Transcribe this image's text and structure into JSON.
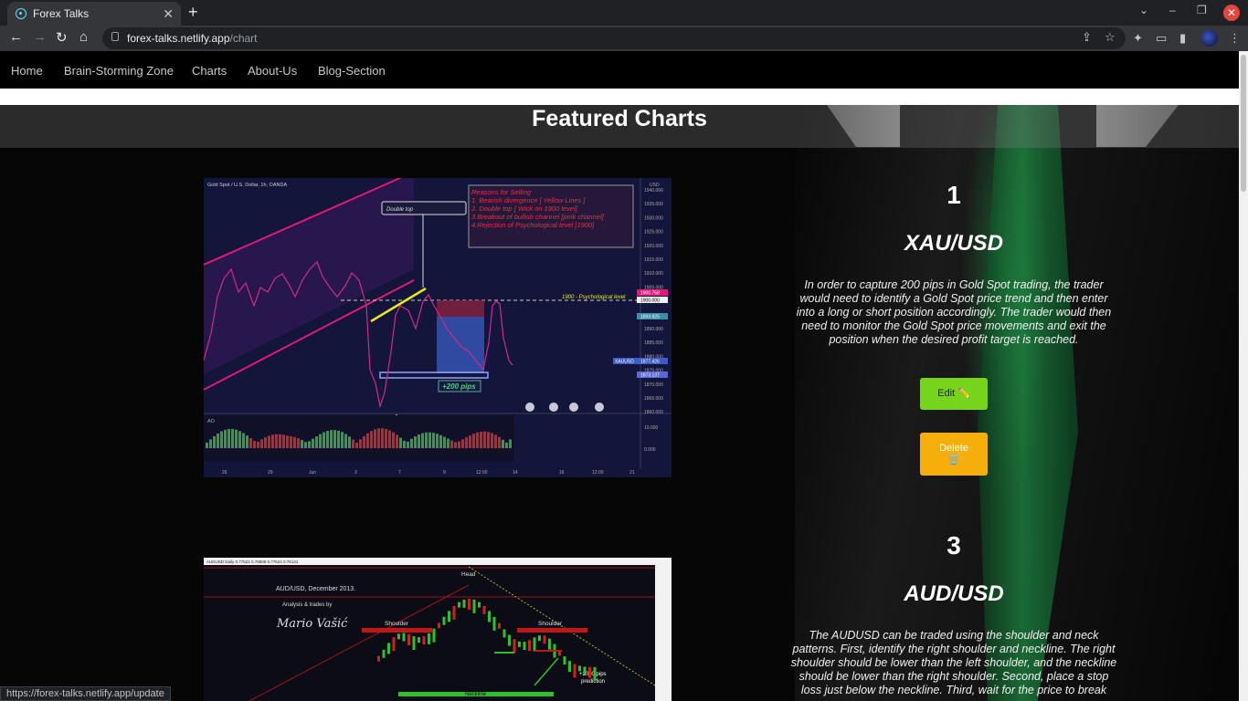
{
  "browser": {
    "tab_title": "Forex Talks",
    "new_tab": "+",
    "tab_close": "✕",
    "url_host": "forex-talks.netlify.app",
    "url_path": "/chart",
    "status_url": "https://forex-talks.netlify.app/update"
  },
  "nav": {
    "items": [
      "Home",
      "Brain-Storming Zone",
      "Charts",
      "About-Us",
      "Blog-Section"
    ]
  },
  "page": {
    "title": "Featured Charts"
  },
  "cards": [
    {
      "number": "1",
      "pair": "XAU/USD",
      "description": "In order to capture 200 pips in Gold Spot trading, the trader would need to identify a Gold Spot price trend and then enter into a long or short position accordingly. The trader would then need to monitor the Gold Spot price movements and exit the position when the desired profit target is reached.",
      "edit_label": "Edit ✏️",
      "delete_label": "Delete",
      "delete_icon": "🗑️"
    },
    {
      "number": "3",
      "pair": "AUD/USD",
      "description": "The AUDUSD can be traded using the shoulder and neck patterns. First, identify the right shoulder and neckline. The right shoulder should be lower than the left shoulder, and the neckline should be lower than the right shoulder. Second, place a stop loss just below the neckline. Third, wait for the price to break"
    }
  ],
  "chart1": {
    "title": "Gold Spot / U.S. Dollar, 1h, OANDA",
    "callout": "Double top",
    "reasons_title": "Reasons for Selling",
    "reasons": [
      "1. Bearish divergence [ Yellow Lines ]",
      "2. Double top [ Wick on 1900 level]",
      "3.Breakout of bullish channel [pink channel]",
      "4.Rejection of Psychological  level [1900]"
    ],
    "level_label": "1900 - Psychological level",
    "pips_label": "+200 pips",
    "price_ticks": [
      "1940.000",
      "1935.000",
      "1930.000",
      "1925.000",
      "1920.000",
      "1915.000",
      "1910.000",
      "1905.000",
      "1900.000",
      "1895.000",
      "1890.000",
      "1885.000",
      "1880.000",
      "1875.000",
      "1870.000",
      "1865.000",
      "1860.000"
    ],
    "price_tags": [
      "1900.758",
      "1900.000",
      "1893.925",
      "1877.426",
      "1873.137"
    ],
    "symbol_tag": "XAUUSD",
    "ao_label": "AO",
    "ao_ticks": [
      "10.000",
      "0.000"
    ],
    "x_ticks": [
      "26",
      "29",
      "Jun",
      "3",
      "7",
      "9",
      "12:00",
      "14",
      "16",
      "12:00",
      "21"
    ],
    "usd_label": "USD"
  },
  "chart2": {
    "header": "AUDUSD Daily  0.77522 0.78508 0.77624 0.78141",
    "title": "AUD/USD, December 2013.",
    "credit": "Analysis & trades by",
    "signature": "Mario Vašić",
    "labels": {
      "head": "Head",
      "left_shoulder": "Shoulder",
      "right_shoulder": "Shoulder",
      "neckline": "Neckline",
      "prediction": "+2000 pips\nprediction"
    }
  }
}
